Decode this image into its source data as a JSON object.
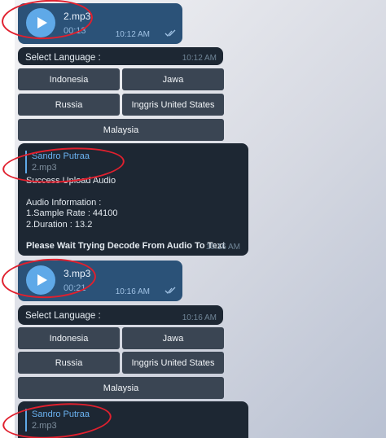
{
  "messages": {
    "voice1": {
      "file": "2.mp3",
      "duration": "00:13",
      "time": "10:12 AM"
    },
    "lang1": {
      "label": "Select Language :",
      "time": "10:12 AM"
    },
    "result": {
      "reply_name": "Sandro Putraa",
      "reply_file": "2.mp3",
      "line1": "Success Upload Audio",
      "line2": "Audio Information :",
      "line3": "1.Sample Rate : 44100",
      "line4": "2.Duration : 13.2",
      "line5": "Please Wait Trying Decode From Audio To Text",
      "time": "10:16 AM"
    },
    "voice2": {
      "file": "3.mp3",
      "duration": "00:21",
      "time": "10:16 AM"
    },
    "lang2": {
      "label": "Select Language :",
      "time": "10:16 AM"
    },
    "reply2": {
      "reply_name": "Sandro Putraa",
      "reply_file": "2.mp3"
    }
  },
  "languages": {
    "indonesia": "Indonesia",
    "jawa": "Jawa",
    "russia": "Russia",
    "inggris": "Inggris United States",
    "malaysia": "Malaysia"
  },
  "colors": {
    "annotation": "#e0202e",
    "voice_bubble": "#2b5278",
    "dark_bubble": "#1d2733",
    "button": "#3a4553",
    "accent": "#5fa9e8"
  }
}
